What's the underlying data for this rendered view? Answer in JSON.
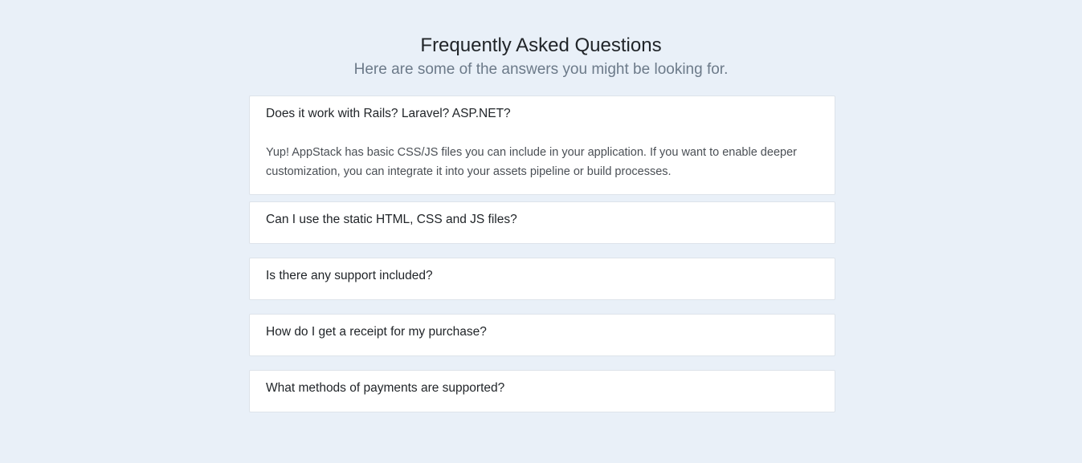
{
  "header": {
    "title": "Frequently Asked Questions",
    "subtitle": "Here are some of the answers you might be looking for."
  },
  "faq": {
    "items": [
      {
        "question": "Does it work with Rails? Laravel? ASP.NET?",
        "answer": "Yup! AppStack has basic CSS/JS files you can include in your application. If you want to enable deeper customization, you can integrate it into your assets pipeline or build processes.",
        "expanded": true
      },
      {
        "question": "Can I use the static HTML, CSS and JS files?",
        "expanded": false
      },
      {
        "question": "Is there any support included?",
        "expanded": false
      },
      {
        "question": "How do I get a receipt for my purchase?",
        "expanded": false
      },
      {
        "question": "What methods of payments are supported?",
        "expanded": false
      }
    ]
  },
  "colors": {
    "page_background": "#e9f0f8",
    "card_background": "#ffffff",
    "subtitle_text": "#6c7a89"
  }
}
